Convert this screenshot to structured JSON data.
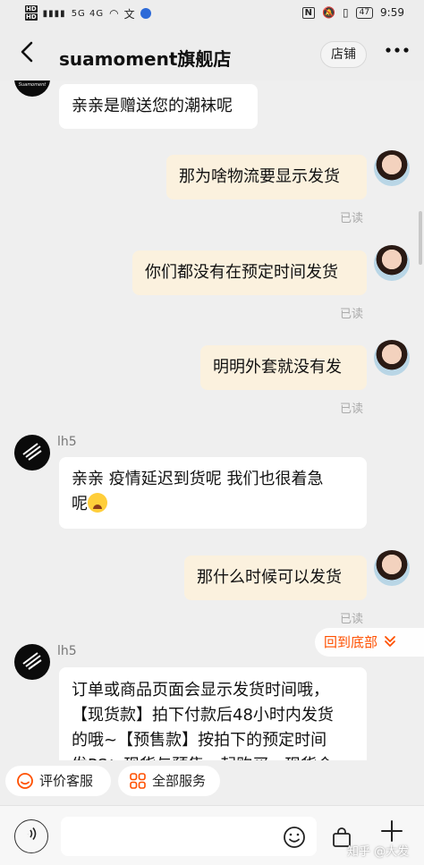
{
  "status_bar": {
    "hd1": "HD",
    "hd2": "HD",
    "signal": "5G 4G",
    "extra": "文",
    "nfc": "N",
    "battery": "47",
    "time": "9:59"
  },
  "header": {
    "back_icon": "chevron-left-icon",
    "title": "suamoment旗舰店",
    "shop_button": "店铺",
    "more_icon": "more-dots-icon"
  },
  "shop": {
    "brand_logo_text": "Suamoment"
  },
  "messages": [
    {
      "from": "shop",
      "text": "亲亲是赠送您的潮袜呢"
    },
    {
      "from": "user",
      "text": "那为啥物流要显示发货",
      "read": "已读"
    },
    {
      "from": "user",
      "text": "你们都没有在预定时间发货",
      "read": "已读"
    },
    {
      "from": "user",
      "text": "明明外套就没有发",
      "read": "已读"
    },
    {
      "from": "shop",
      "nick": "lh5",
      "text_line1": "亲亲 疫情延迟到货呢 我们也很着急",
      "text_line2": "呢",
      "emoji": "crying-face-icon"
    },
    {
      "from": "user",
      "text": "那什么时候可以发货",
      "read": "已读"
    },
    {
      "from": "shop",
      "nick": "lh5",
      "lines": [
        "订单或商品页面会显示发货时间哦，",
        "【现货款】拍下付款后48小时内发货",
        "的哦~【预售款】按拍下的预定时间",
        "发PS：现货与预售一起购买，现货会"
      ]
    }
  ],
  "back_to_bottom": {
    "label": "回到底部",
    "icon": "chevron-double-down-icon"
  },
  "quick_actions": [
    {
      "label": "评价客服",
      "icon": "smile-rate-icon"
    },
    {
      "label": "全部服务",
      "icon": "grid-services-icon"
    }
  ],
  "input_bar": {
    "voice_icon": "voice-icon",
    "emoji_icon": "smile-icon",
    "bag_icon": "shopping-bag-icon",
    "plus_icon": "plus-icon",
    "watermark": "知乎 @大发"
  },
  "colors": {
    "accent": "#ff5000",
    "user_bubble": "#fbf1de",
    "shop_bubble": "#ffffff",
    "background": "#efefef"
  }
}
